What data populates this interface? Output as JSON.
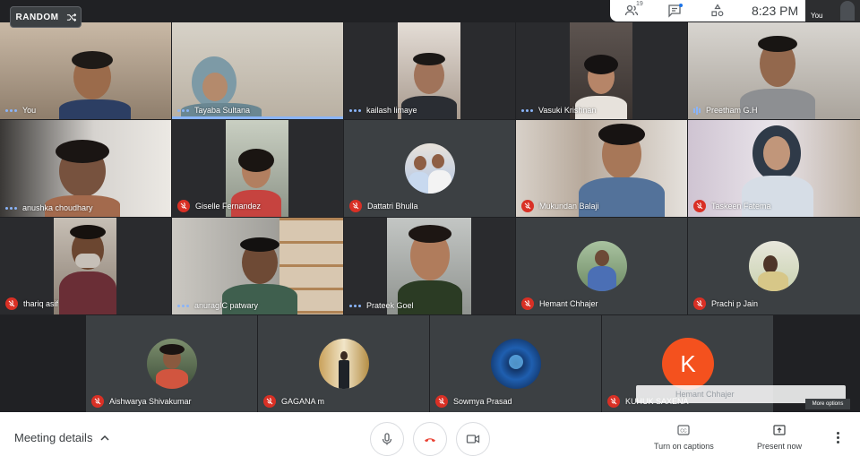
{
  "random_button": {
    "label": "RANDOM",
    "icon": "shuffle-icon"
  },
  "topbar": {
    "participant_count": "19",
    "time": "8:23  PM",
    "icons": [
      "people-icon",
      "chat-icon",
      "activities-icon"
    ]
  },
  "self_view": {
    "label": "You"
  },
  "participants": [
    {
      "name": "You",
      "state": "active"
    },
    {
      "name": "Tayaba Sultana",
      "state": "speaking"
    },
    {
      "name": "kailash limaye",
      "state": "active"
    },
    {
      "name": "Vasuki Krishnan",
      "state": "active"
    },
    {
      "name": "Preetham G.H",
      "state": "talking"
    },
    {
      "name": "anushka choudhary",
      "state": "active"
    },
    {
      "name": "Giselle Fernandez",
      "state": "muted"
    },
    {
      "name": "Dattatri Bhulla",
      "state": "muted"
    },
    {
      "name": "Mukundan Balaji",
      "state": "muted"
    },
    {
      "name": "Taskeen Fatema",
      "state": "muted"
    },
    {
      "name": "thariq asif",
      "state": "muted"
    },
    {
      "name": "anuragIC patwary",
      "state": "active"
    },
    {
      "name": "Prateek Goel",
      "state": "active"
    },
    {
      "name": "Hemant Chhajer",
      "state": "muted"
    },
    {
      "name": "Prachi p Jain",
      "state": "muted"
    },
    {
      "name": "Aishwarya Shivakumar",
      "state": "muted"
    },
    {
      "name": "GAGANA m",
      "state": "muted"
    },
    {
      "name": "Sowmya Prasad",
      "state": "muted"
    },
    {
      "name": "KUHUK SAXENA",
      "state": "muted",
      "avatar_letter": "K"
    }
  ],
  "ghost_banner": "Hemant Chhajer",
  "more_options": "More options",
  "bottombar": {
    "meeting_details": "Meeting details",
    "captions_label": "Turn on captions",
    "present_label": "Present now",
    "captions_icon_text": "CC"
  },
  "colors": {
    "accent_blue": "#8ab4f8",
    "mute_red": "#d93025",
    "hangup_red": "#ea4335",
    "avatar_orange": "#f4511e",
    "tile_bg": "#3c4043",
    "stage_bg": "#202124"
  }
}
